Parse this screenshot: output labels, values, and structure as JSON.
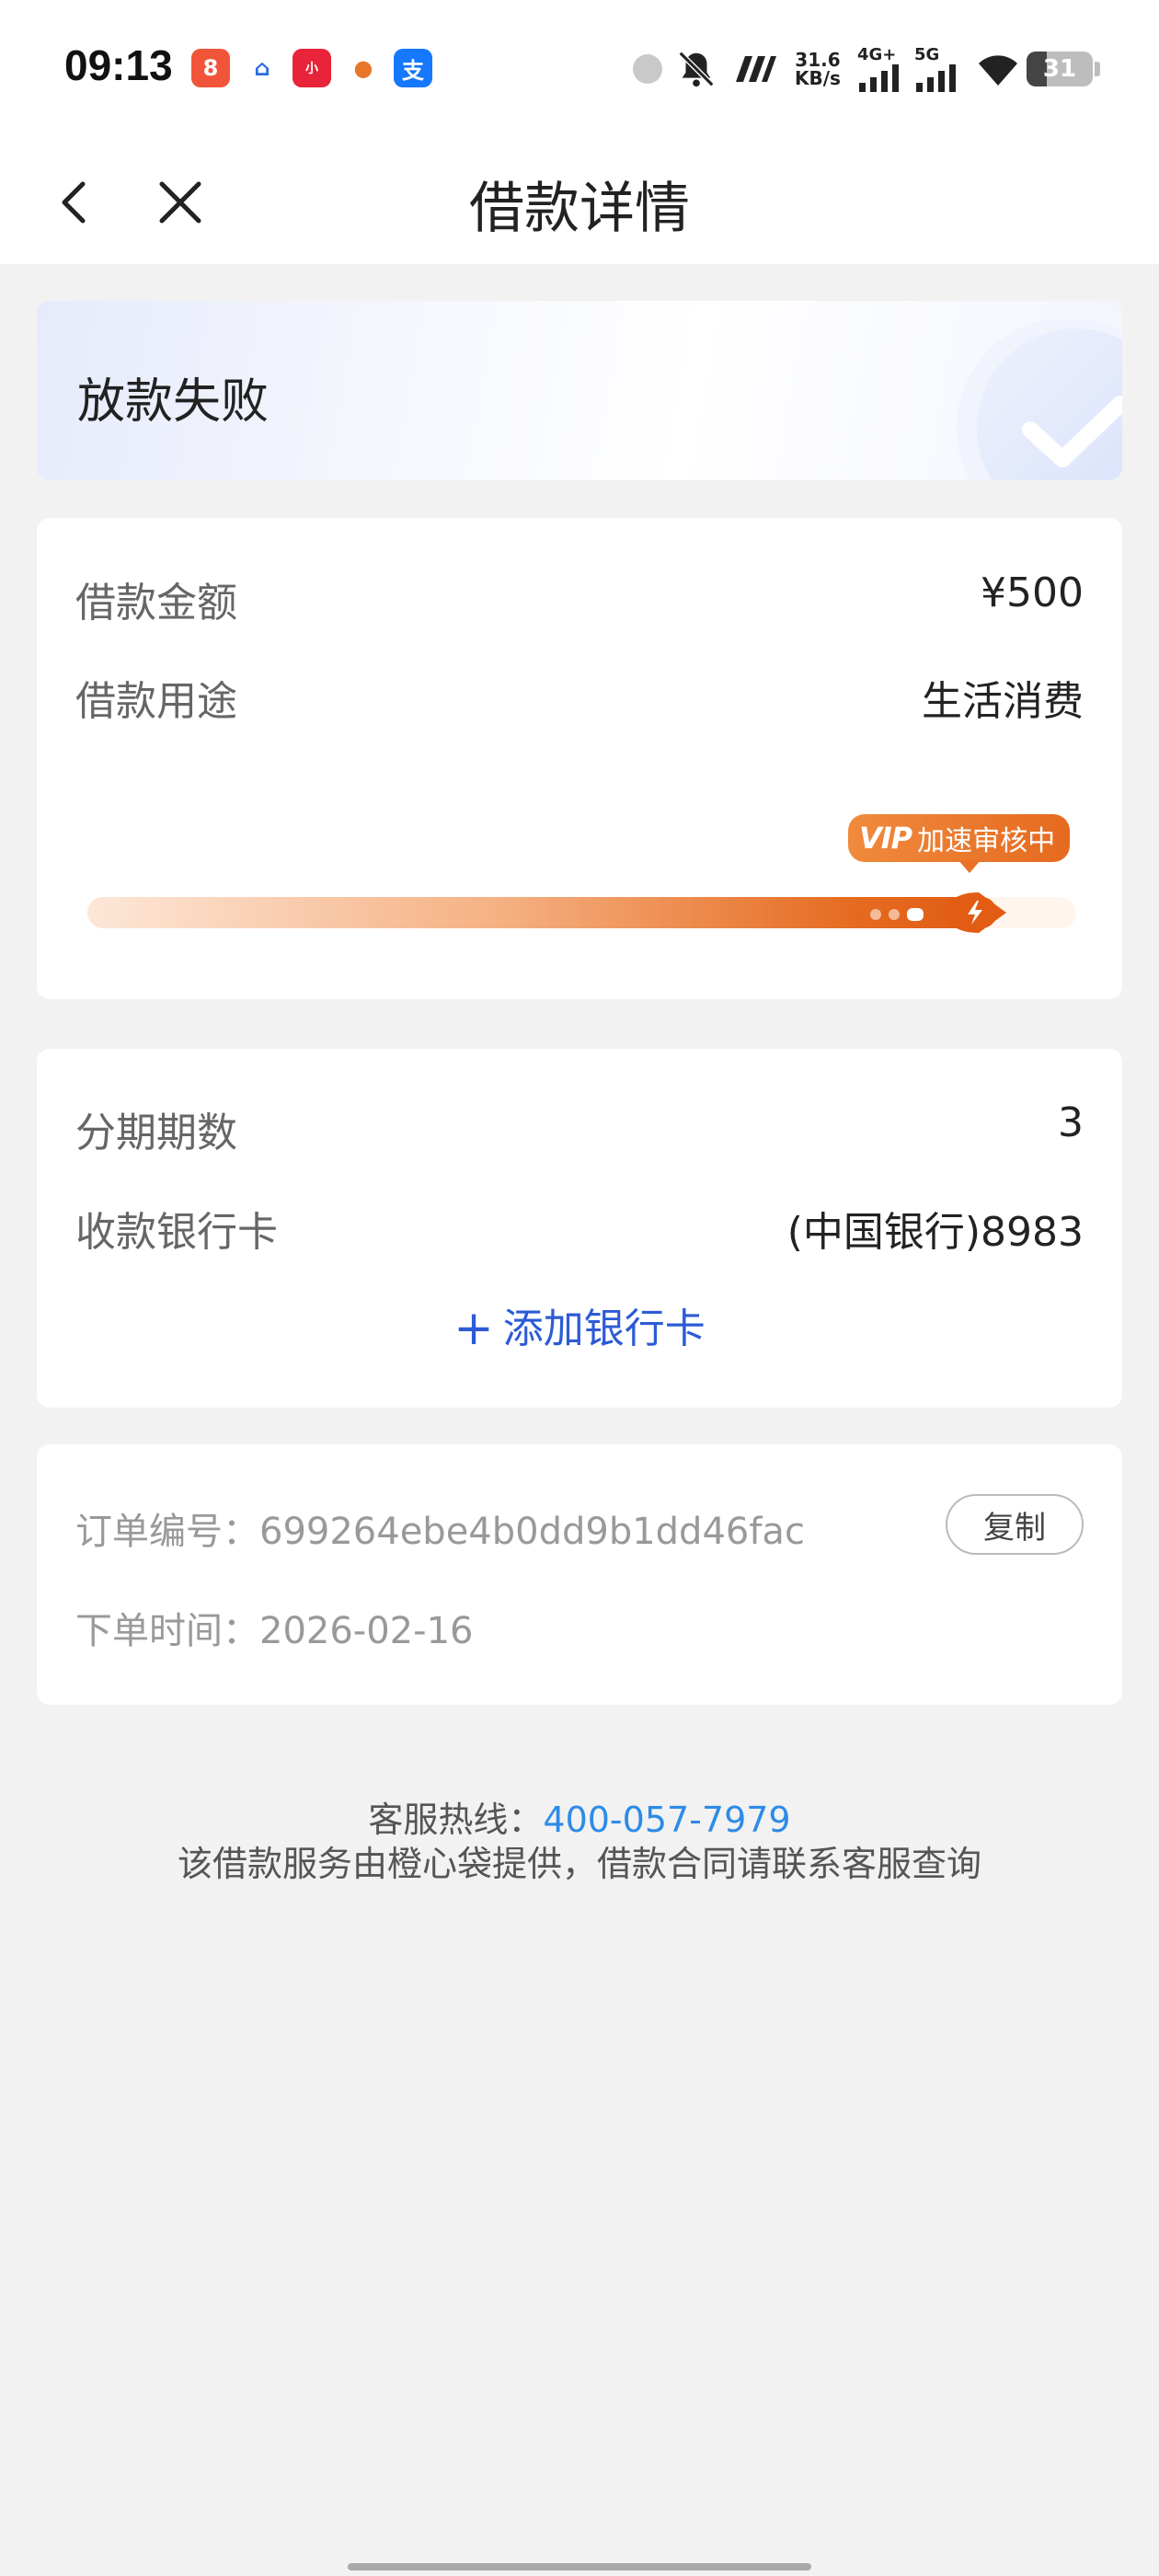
{
  "status_bar": {
    "time": "09:13",
    "network_speed_value": "31.6",
    "network_speed_unit": "KB/s",
    "signal_1_label": "4G+",
    "signal_2_label": "5G",
    "battery": "31",
    "battery_level": 0.31
  },
  "nav": {
    "title": "借款详情"
  },
  "status_card": {
    "status": "放款失败"
  },
  "loan": {
    "amount_label": "借款金额",
    "amount_value": "¥500",
    "purpose_label": "借款用途",
    "purpose_value": "生活消费",
    "vip_tag": "VIP",
    "review_status": "加速审核中",
    "progress": 0.92
  },
  "installment": {
    "periods_label": "分期期数",
    "periods_value": "3",
    "bank_label": "收款银行卡",
    "bank_value": "(中国银行)8983",
    "add_card_label": "添加银行卡"
  },
  "order": {
    "number_label": "订单编号：",
    "number_value": "699264ebe4b0dd9b1dd46fac",
    "copy_label": "复制",
    "time_label": "下单时间：",
    "time_value": "2026-02-16"
  },
  "footer": {
    "hotline_label": "客服热线：",
    "hotline_number": "400-057-7979",
    "notice": "该借款服务由橙心袋提供，借款合同请联系客服查询"
  },
  "colors": {
    "accent_blue": "#2d5bd6",
    "hotline_blue": "#2d8be8",
    "progress_orange": "#e56a1f"
  }
}
